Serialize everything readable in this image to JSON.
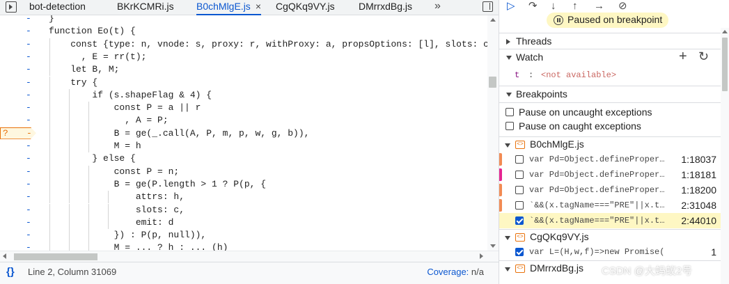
{
  "editor": {
    "tabs": [
      {
        "label": "bot-detection"
      },
      {
        "label": "BKrKCMRi.js"
      },
      {
        "label": "B0chMlgE.js",
        "close": "×"
      },
      {
        "label": "CgQKq9VY.js"
      },
      {
        "label": "DMrrxdBg.js"
      }
    ],
    "more_tabs": "»",
    "active_tab": "B0chMlgE.js",
    "lines": [
      {
        "text": "}"
      },
      {
        "text": "function Eo(t) {"
      },
      {
        "text": "    const {type: n, vnode: s, proxy: r, withProxy: a, propsOptions: [l], slots: c, attrs:"
      },
      {
        "text": "      , E = rr(t);"
      },
      {
        "text": "    let B, M;"
      },
      {
        "text": "    try {"
      },
      {
        "text": "        if (s.shapeFlag & 4) {"
      },
      {
        "text": "            const P = a || r"
      },
      {
        "text": "              , A = P;"
      },
      {
        "text": "            B = ge(_.call(A, P, m, p, w, g, b)),",
        "breakpoint": "?"
      },
      {
        "text": "            M = h"
      },
      {
        "text": "        } else {"
      },
      {
        "text": "            const P = n;"
      },
      {
        "text": "            B = ge(P.length > 1 ? P(p, {"
      },
      {
        "text": "                attrs: h,"
      },
      {
        "text": "                slots: c,"
      },
      {
        "text": "                emit: d"
      },
      {
        "text": "            }) : P(p, null)),"
      },
      {
        "text": "            M = ... ? h : ... (h)"
      }
    ],
    "status": {
      "position": "Line 2, Column 31069",
      "coverage_label": "Coverage:",
      "coverage_value": "n/a"
    }
  },
  "debugger": {
    "paused_label": "Paused on breakpoint",
    "sections": {
      "threads": "Threads",
      "watch": "Watch",
      "breakpoints": "Breakpoints"
    },
    "watch": [
      {
        "name": "t",
        "sep": ":",
        "value": "<not available>"
      }
    ],
    "exceptions": [
      {
        "label": "Pause on uncaught exceptions",
        "checked": false
      },
      {
        "label": "Pause on caught exceptions",
        "checked": false
      }
    ],
    "files": [
      {
        "name": "B0chMlgE.js",
        "breakpoints": [
          {
            "code": "var Pd=Object.defineProper…",
            "line": "1:18037",
            "checked": false,
            "color": "#f28b54"
          },
          {
            "code": "var Pd=Object.defineProper…",
            "line": "1:18181",
            "checked": false,
            "color": "#e52592"
          },
          {
            "code": "var Pd=Object.defineProper…",
            "line": "1:18200",
            "checked": false,
            "color": "#f28b54"
          },
          {
            "code": "`&&(x.tagName===\"PRE\"||x.t…",
            "line": "2:31048",
            "checked": false,
            "color": "#f28b54"
          },
          {
            "code": "`&&(x.tagName===\"PRE\"||x.t…",
            "line": "2:44010",
            "checked": true,
            "selected": true,
            "color": ""
          }
        ]
      },
      {
        "name": "CgQKq9VY.js",
        "breakpoints": [
          {
            "code": "var L=(H,w,f)=>new Promise((j,y…",
            "line": "1",
            "checked": true,
            "color": ""
          }
        ]
      },
      {
        "name": "DMrrxdBg.js",
        "breakpoints": []
      }
    ]
  },
  "watermark": "CSDN @大蚂蚁2号"
}
